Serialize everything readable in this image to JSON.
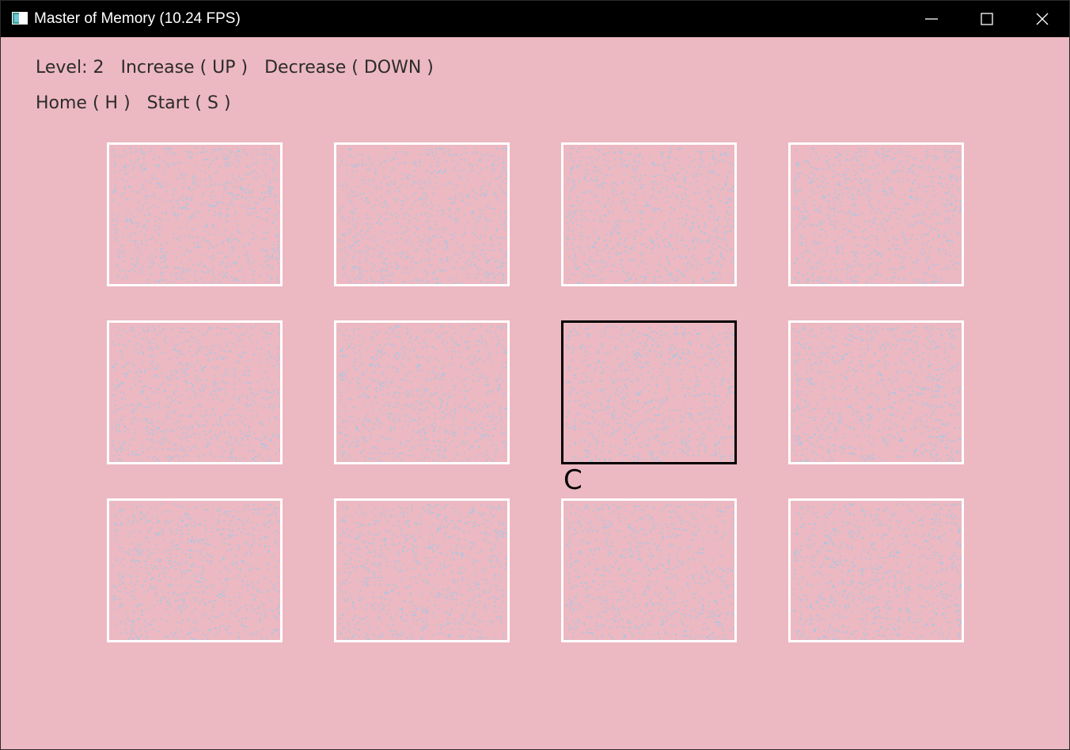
{
  "window": {
    "title": "Master of Memory (10.24 FPS)"
  },
  "hud": {
    "level": "Level: 2",
    "increase": "Increase ( UP )",
    "decrease": "Decrease ( DOWN )",
    "home": "Home ( H )",
    "start": "Start ( S )"
  },
  "board": {
    "rows": 3,
    "cols": 4,
    "selected_tile": 6,
    "selected_label": "C"
  },
  "colors": {
    "background": "#ecb8c1",
    "tile_border": "#ffffff",
    "selected_border": "#000000",
    "noise_dot": "#9ec9e8"
  }
}
